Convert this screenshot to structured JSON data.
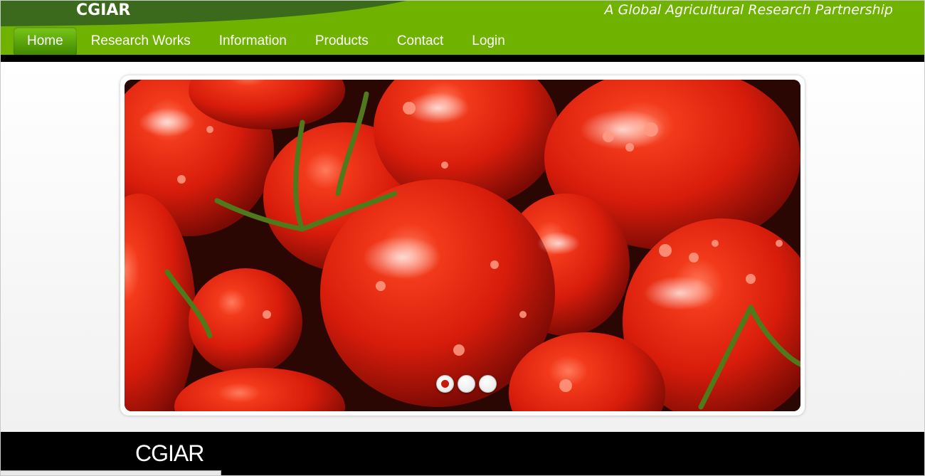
{
  "header": {
    "logo": "CGIAR",
    "tagline": "A Global Agricultural Research Partnership"
  },
  "nav": {
    "items": [
      {
        "label": "Home",
        "active": true
      },
      {
        "label": "Research Works",
        "active": false
      },
      {
        "label": "Information",
        "active": false
      },
      {
        "label": "Products",
        "active": false
      },
      {
        "label": "Contact",
        "active": false
      },
      {
        "label": "Login",
        "active": false
      }
    ]
  },
  "slider": {
    "slide_count": 3,
    "active_index": 0,
    "image": "tomatoes-photo"
  },
  "footer": {
    "title": "CGIAR"
  },
  "colors": {
    "brand_green": "#6fb200",
    "dark_green": "#3f8800",
    "black": "#000000",
    "tomato_red": "#d8210f"
  }
}
